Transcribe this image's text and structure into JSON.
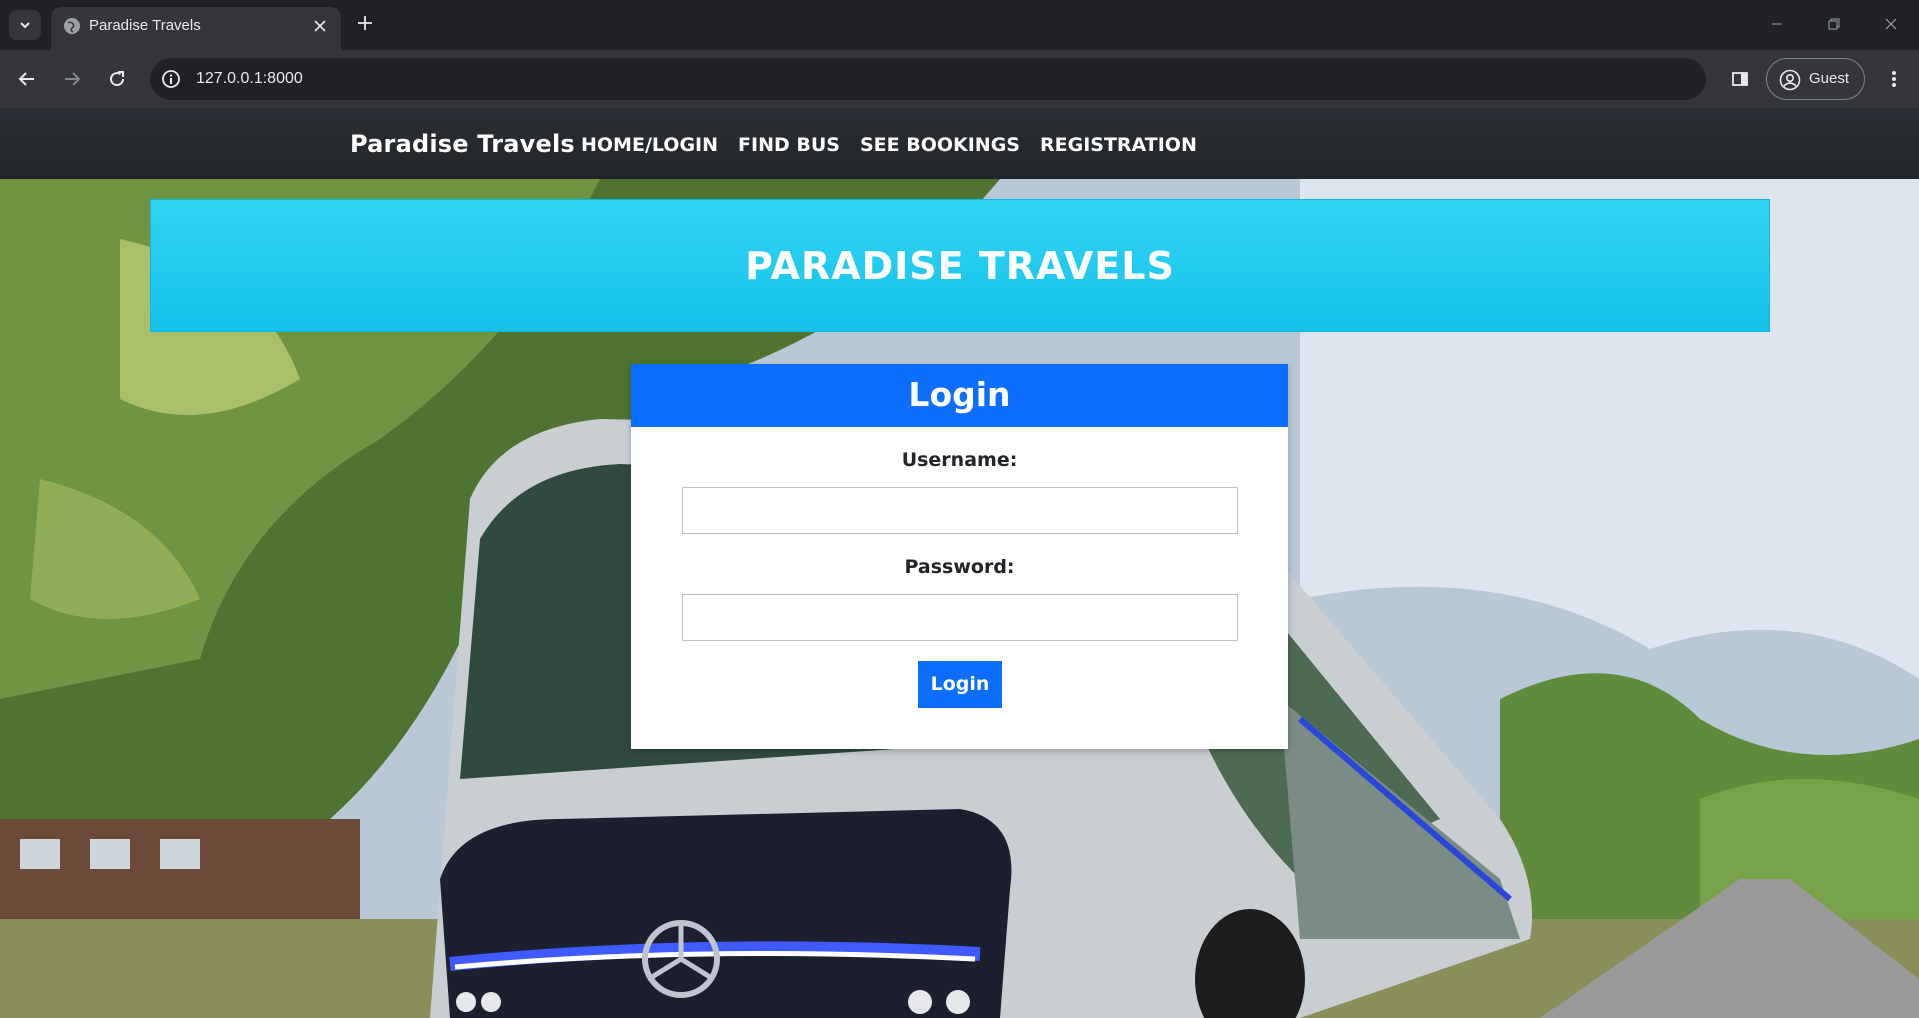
{
  "browser": {
    "tab": {
      "title": "Paradise Travels"
    },
    "address_bar": {
      "url": "127.0.0.1:8000"
    },
    "profile": {
      "label": "Guest"
    },
    "icons": [
      "tab-list-icon",
      "globe-favicon-icon",
      "close-icon",
      "plus-icon",
      "minimize-icon",
      "restore-icon",
      "window-close-icon",
      "back-arrow-icon",
      "forward-arrow-icon",
      "reload-icon",
      "site-info-icon",
      "side-panel-icon",
      "profile-icon",
      "kebab-menu-icon"
    ]
  },
  "page": {
    "navbar": {
      "brand": "Paradise Travels",
      "links": [
        {
          "label": "HOME/LOGIN"
        },
        {
          "label": "FIND BUS"
        },
        {
          "label": "SEE BOOKINGS"
        },
        {
          "label": "REGISTRATION"
        }
      ]
    },
    "banner": {
      "title": "PARADISE TRAVELS"
    },
    "login_card": {
      "title": "Login",
      "username_label": "Username:",
      "username_value": "",
      "password_label": "Password:",
      "password_value": "",
      "submit_label": "Login"
    },
    "colors": {
      "navbar_bg": "#212529",
      "banner_bg": "#1cc8ee",
      "primary_button": "#0d6efd",
      "card_bg": "#ffffff"
    }
  }
}
